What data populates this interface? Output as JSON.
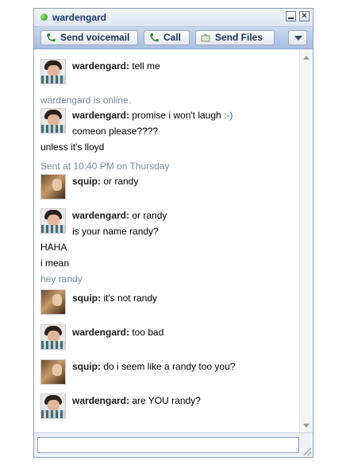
{
  "window": {
    "title": "wardengard"
  },
  "toolbar": {
    "voicemail_label": "Send voicemail",
    "call_label": "Call",
    "files_label": "Send Files"
  },
  "chat": {
    "m1": {
      "sender": "wardengard:",
      "text": " tell me"
    },
    "status1": "wardengard is online.",
    "m2": {
      "sender": "wardengard:",
      "text": " promise i won't laugh ",
      "emoticon": ":-)"
    },
    "m2b": "comeon please????",
    "line1": "unless it's lloyd",
    "status2": "Sent at 10:40 PM on Thursday",
    "m3": {
      "sender": "squip:",
      "text": " or randy"
    },
    "m4": {
      "sender": "wardengard:",
      "text": " or randy"
    },
    "m4b": "is your name randy?",
    "line2": "HAHA",
    "line3": "i mean",
    "status3": "hey randy",
    "m5": {
      "sender": "squip:",
      "text": " it's not randy"
    },
    "m6": {
      "sender": "wardengard:",
      "text": " too bad"
    },
    "m7": {
      "sender": "squip:",
      "text": " do i seem like a randy too you?"
    },
    "m8": {
      "sender": "wardengard:",
      "text": " are YOU randy?"
    }
  },
  "icons": {
    "presence": "online-dot-icon",
    "voicemail": "phone-icon",
    "call": "phone-icon",
    "files": "file-transfer-icon",
    "more": "chevron-down-icon"
  },
  "colors": {
    "presence": "#2e9a1a",
    "toolbar": "#b9cbe7",
    "status_text": "#7f8a96"
  }
}
